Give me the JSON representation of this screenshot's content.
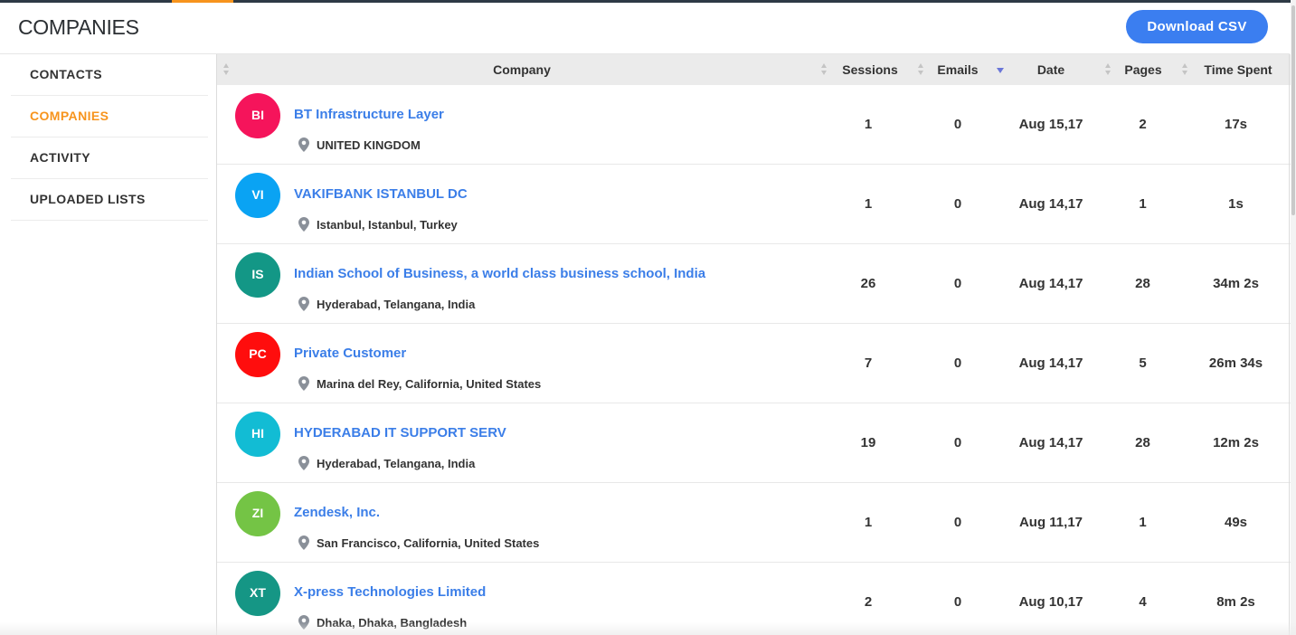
{
  "header": {
    "title": "COMPANIES",
    "download_label": "Download CSV"
  },
  "colors": {
    "accent": "#f7941d",
    "link": "#3b7ee8",
    "button": "#3b7ef0"
  },
  "sidebar": {
    "items": [
      {
        "label": "CONTACTS",
        "active": false
      },
      {
        "label": "COMPANIES",
        "active": true
      },
      {
        "label": "ACTIVITY",
        "active": false
      },
      {
        "label": "UPLOADED LISTS",
        "active": false
      }
    ]
  },
  "table": {
    "columns": {
      "company": "Company",
      "sessions": "Sessions",
      "emails": "Emails",
      "date": "Date",
      "pages": "Pages",
      "time": "Time Spent"
    },
    "sorted_by": "Date",
    "rows": [
      {
        "initials": "BI",
        "color": "#f5145b",
        "name": "BT Infrastructure Layer",
        "location": "UNITED KINGDOM",
        "sessions": "1",
        "emails": "0",
        "date": "Aug 15,17",
        "pages": "2",
        "time": "17s"
      },
      {
        "initials": "VI",
        "color": "#0aa3f3",
        "name": "VAKIFBANK ISTANBUL DC",
        "location": "Istanbul, Istanbul, Turkey",
        "sessions": "1",
        "emails": "0",
        "date": "Aug 14,17",
        "pages": "1",
        "time": "1s"
      },
      {
        "initials": "IS",
        "color": "#139786",
        "name": "Indian School of Business, a world class business school, India",
        "location": "Hyderabad, Telangana, India",
        "sessions": "26",
        "emails": "0",
        "date": "Aug 14,17",
        "pages": "28",
        "time": "34m 2s"
      },
      {
        "initials": "PC",
        "color": "#ff0d0d",
        "name": "Private Customer",
        "location": "Marina del Rey, California, United States",
        "sessions": "7",
        "emails": "0",
        "date": "Aug 14,17",
        "pages": "5",
        "time": "26m 34s"
      },
      {
        "initials": "HI",
        "color": "#12bcd4",
        "name": "HYDERABAD IT SUPPORT SERV",
        "location": "Hyderabad, Telangana, India",
        "sessions": "19",
        "emails": "0",
        "date": "Aug 14,17",
        "pages": "28",
        "time": "12m 2s"
      },
      {
        "initials": "ZI",
        "color": "#74c445",
        "name": "Zendesk, Inc.",
        "location": "San Francisco, California, United States",
        "sessions": "1",
        "emails": "0",
        "date": "Aug 11,17",
        "pages": "1",
        "time": "49s"
      },
      {
        "initials": "XT",
        "color": "#159685",
        "name": "X-press Technologies Limited",
        "location": "Dhaka, Dhaka, Bangladesh",
        "sessions": "2",
        "emails": "0",
        "date": "Aug 10,17",
        "pages": "4",
        "time": "8m 2s"
      }
    ]
  }
}
